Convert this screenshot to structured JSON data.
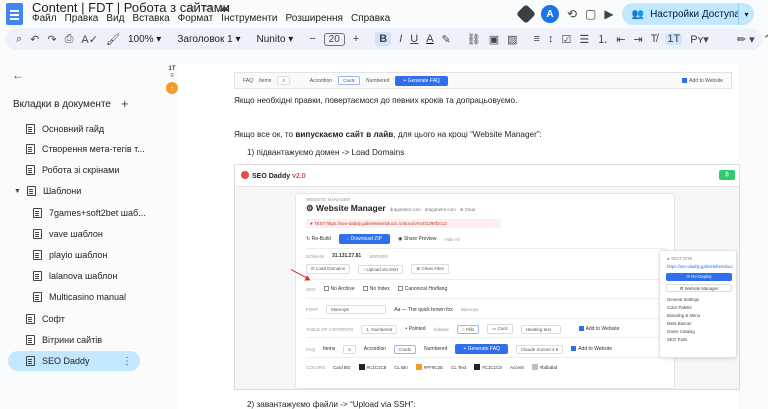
{
  "doc": {
    "title": "Content | FDT | Робота з сайтами",
    "menu": [
      "Файл",
      "Правка",
      "Вид",
      "Вставка",
      "Формат",
      "Інструменти",
      "Розширення",
      "Справка"
    ],
    "avatar_letter": "A",
    "share_label": "Настройки Доступа"
  },
  "toolbar": {
    "zoom": "100%",
    "style": "Заголовок 1",
    "font": "Nunito",
    "font_size": "20",
    "bold": "B",
    "italic": "I",
    "underline": "U",
    "text_color": "A"
  },
  "sidebar": {
    "header": "Вкладки в документе",
    "tabs": [
      {
        "label": "Основний гайд"
      },
      {
        "label": "Створення мета-тегів т..."
      },
      {
        "label": "Робота зі скрінами"
      },
      {
        "label": "Шаблони"
      },
      {
        "label": "7games+soft2bet шаб..."
      },
      {
        "label": "vave шаблон"
      },
      {
        "label": "playio шаблон"
      },
      {
        "label": "lalanova шаблон"
      },
      {
        "label": "Multicasino manual"
      },
      {
        "label": "Софт"
      },
      {
        "label": "Вітрини сайтів"
      },
      {
        "label": "SEO Daddy"
      }
    ]
  },
  "body": {
    "para1": "Якщо необхідні правки, повертаємося до певних кроків та допрацьовуємо.",
    "para2_pre": "Якщо все ок, то ",
    "para2_bold": "випускаємо сайт в лайв",
    "para2_post": ", для цього на кроці “Website Manager”:",
    "step1": "1)   підвантажуємо домен  -> Load Domains",
    "step2": "2)   завантажуємо файли -> “Upload via SSH”:"
  },
  "strip": {
    "faq": "FAQ",
    "items_label": "Items",
    "items_value": "3",
    "accordion": "Accordion",
    "cards": "Cards",
    "numbered": "Numbered",
    "generate": "+ Generate FAQ",
    "add_to_website": "Add to Website"
  },
  "screenshot": {
    "logo": "SEO Daddy",
    "version": "v2.0",
    "badge": "₿",
    "section": "WEBSITE MANAGER",
    "title": "⚙ Website Manager",
    "domain": "dragobetnl.com",
    "domain_sub": "dragobetnl.com",
    "clear": "⊗ Clear",
    "test": "● TEST   https://seo-daddy.gabrielebertolucci.ro/docs/v/rn4f1298f2c12",
    "rebuild": "↻ Re-Build",
    "download": "↓ Download ZIP",
    "preview": "◉ Share Preview",
    "hide": "Hide All",
    "domain_label": "DOMAIN",
    "ip": "31.131.27.81",
    "server": "SERVER",
    "load": "⟳ Load Domains",
    "ssh": "↑ Upload via SSH",
    "clean": "⊗ Clean Files",
    "seo": "SEO",
    "no_archive": "No Archive",
    "no_index": "No Index",
    "canonical": "Canonical Hreflang",
    "font_label": "FONT",
    "font_value": "Manrope",
    "font_sample": "Aa — The quick brown fox",
    "font_sample_sub": "Manrope",
    "toc": "TABLE OF CONTENTS",
    "toc_numbered": "1. Numbered",
    "toc_pointed": "• Pointed",
    "toc_sidebar": "Sidebar",
    "toc_pills": "○ Pills",
    "toc_card": "▭ Card",
    "toc_heading": "Heading text",
    "add_to_website": "Add to Website",
    "faq": "FAQ",
    "items_label": "Items",
    "items_value": "4",
    "accordion": "Accordion",
    "cards": "Cards",
    "numbered": "Numbered",
    "generate": "+ Generate FAQ",
    "claude": "Claude Sonnet 4.6",
    "colors": "COLORS",
    "card_bg": "Card BG",
    "card_bg_hex": "#C1C1C8",
    "cl_btn": "CL Btn",
    "cl_btn_hex": "#FF9C2E",
    "cl_text": "CL Text",
    "cl_text_hex": "#C1C1C8",
    "accent": "Accent",
    "accent_hex": "#bdbdbd",
    "popup": {
      "test_site": "● TEST SITE",
      "url": "https://seo-daddy.gabrielebertolucci...",
      "redeploy": "⟳ Re-Deploy",
      "manager": "⚙ Website Manager",
      "items": [
        "General Settings",
        "Color Palette",
        "Branding & Menu",
        "Meta Banner",
        "Game Catalog",
        "SEO Tools"
      ]
    }
  },
  "colors": {
    "accent_blue": "#1a73e8",
    "share_bg": "#c2e7ff",
    "active_tab": "#c2e7ff",
    "sd_red": "#e04b4b",
    "button_blue": "#2f6fed"
  }
}
